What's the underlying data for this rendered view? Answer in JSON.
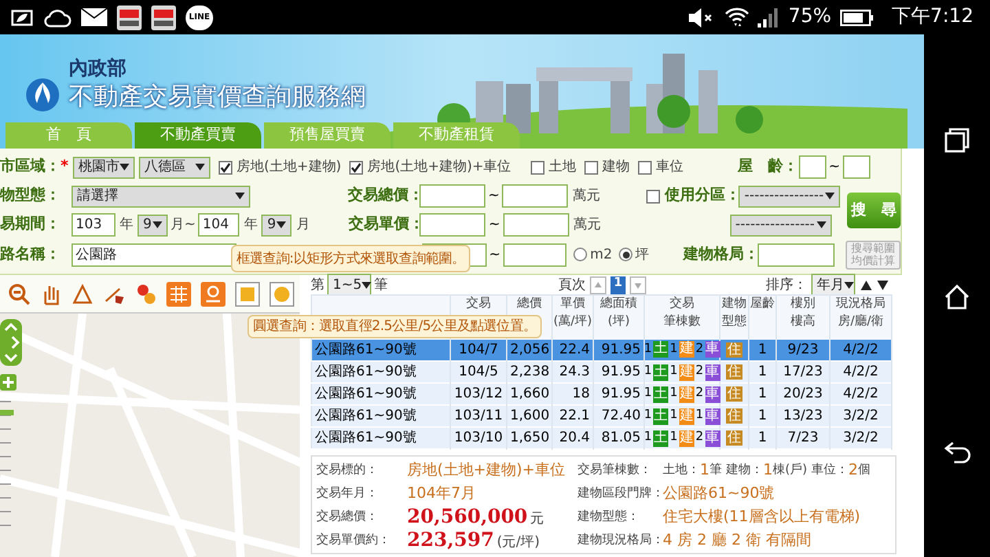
{
  "status_bar": {
    "apps": [
      {
        "kind": "youku"
      },
      {
        "kind": "youku"
      },
      {
        "kind": "line",
        "label": "LINE"
      }
    ],
    "battery": "75%",
    "time": "下午7:12"
  },
  "header": {
    "ministry": "內政部",
    "site_title": "不動產交易實價查詢服務網"
  },
  "nav_tabs": [
    {
      "label": "首　頁",
      "selected": false
    },
    {
      "label": "不動產買賣",
      "selected": true
    },
    {
      "label": "預售屋買賣",
      "selected": false
    },
    {
      "label": "不動產租賃",
      "selected": false
    }
  ],
  "form": {
    "area": {
      "label": "市區域：",
      "required_mark": "*",
      "city": "桃園市",
      "district": "八德區"
    },
    "property_types": [
      {
        "label": "房地(土地+建物)",
        "checked": true
      },
      {
        "label": "房地(土地+建物)+車位",
        "checked": true
      },
      {
        "label": "土地",
        "checked": false
      },
      {
        "label": "建物",
        "checked": false
      },
      {
        "label": "車位",
        "checked": false
      }
    ],
    "age": {
      "label": "屋　齡：",
      "separator": "~"
    },
    "building_type": {
      "label": "物型態：",
      "value": "請選擇"
    },
    "total_price": {
      "label": "交易總價：",
      "separator": "~",
      "unit": "萬元"
    },
    "unit_price": {
      "label": "交易單價：",
      "separator": "~",
      "unit": "萬元"
    },
    "period": {
      "label": "易期間：",
      "from_year": "103",
      "from_year_unit": "年",
      "from_month": "9",
      "from_month_unit": "月~",
      "to_year": "104",
      "to_year_unit": "年",
      "to_month": "9",
      "to_month_unit": "月"
    },
    "road": {
      "label": "路名稱：",
      "value": "公園路"
    },
    "floor_area": {
      "separator": "~",
      "units": [
        {
          "label": "m2",
          "selected": false
        },
        {
          "label": "坪",
          "selected": true
        }
      ]
    },
    "zoning": {
      "label": "使用分區：",
      "checked": false,
      "select_1": "----------------",
      "select_2": "----------------"
    },
    "layout": {
      "label": "建物格局："
    },
    "search_button": "搜　尋",
    "calc_button": "搜尋範圍均價計算"
  },
  "tooltips": [
    "框選查詢:以矩形方式來選取查詢範圍。",
    "圓選查詢：選取直徑2.5公里/5公里及點選位置。"
  ],
  "pager": {
    "prefix": "第",
    "range": "1~5",
    "suffix": "筆",
    "page_label": "頁次",
    "page": "1",
    "sort_label": "排序：",
    "sort_value": "年月"
  },
  "table": {
    "columns": [
      [
        "交易"
      ],
      [
        "總價"
      ],
      [
        "單價",
        "(萬/坪)"
      ],
      [
        "總面積",
        "(坪)"
      ],
      [
        "交易",
        "筆棟數"
      ],
      [
        "建物",
        "型態"
      ],
      [
        "屋齡"
      ],
      [
        "樓別",
        "樓高"
      ],
      [
        "現況格局",
        "房/廳/衛"
      ]
    ],
    "rows": [
      {
        "selected": true,
        "address": "公園路61~90號",
        "date": "104/7",
        "total": "2,056",
        "unit": "22.4",
        "area": "91.95",
        "counts": [
          {
            "n": "1",
            "tag": "土",
            "color": "#1e9a1e"
          },
          {
            "n": "1",
            "tag": "建",
            "color": "#f28c16"
          },
          {
            "n": "2",
            "tag": "車",
            "color": "#8a4fd6"
          }
        ],
        "type_tag": "住",
        "age": "1",
        "floor": "9/23",
        "layout": "4/2/2"
      },
      {
        "selected": false,
        "address": "公園路61~90號",
        "date": "104/5",
        "total": "2,238",
        "unit": "24.3",
        "area": "91.95",
        "counts": [
          {
            "n": "1",
            "tag": "土",
            "color": "#1e9a1e"
          },
          {
            "n": "1",
            "tag": "建",
            "color": "#f28c16"
          },
          {
            "n": "2",
            "tag": "車",
            "color": "#8a4fd6"
          }
        ],
        "type_tag": "住",
        "age": "1",
        "floor": "17/23",
        "layout": "4/2/2"
      },
      {
        "selected": false,
        "address": "公園路61~90號",
        "date": "103/12",
        "total": "1,660",
        "unit": "18",
        "area": "91.95",
        "counts": [
          {
            "n": "1",
            "tag": "土",
            "color": "#1e9a1e"
          },
          {
            "n": "1",
            "tag": "建",
            "color": "#f28c16"
          },
          {
            "n": "2",
            "tag": "車",
            "color": "#8a4fd6"
          }
        ],
        "type_tag": "住",
        "age": "1",
        "floor": "20/23",
        "layout": "4/2/2"
      },
      {
        "selected": false,
        "address": "公園路61~90號",
        "date": "103/11",
        "total": "1,600",
        "unit": "22.1",
        "area": "72.40",
        "counts": [
          {
            "n": "1",
            "tag": "土",
            "color": "#1e9a1e"
          },
          {
            "n": "1",
            "tag": "建",
            "color": "#f28c16"
          },
          {
            "n": "1",
            "tag": "車",
            "color": "#8a4fd6"
          }
        ],
        "type_tag": "住",
        "age": "1",
        "floor": "13/23",
        "layout": "3/2/2"
      },
      {
        "selected": false,
        "address": "公園路61~90號",
        "date": "103/10",
        "total": "1,650",
        "unit": "20.4",
        "area": "81.05",
        "counts": [
          {
            "n": "1",
            "tag": "土",
            "color": "#1e9a1e"
          },
          {
            "n": "1",
            "tag": "建",
            "color": "#f28c16"
          },
          {
            "n": "2",
            "tag": "車",
            "color": "#8a4fd6"
          }
        ],
        "type_tag": "住",
        "age": "1",
        "floor": "7/23",
        "layout": "3/2/2"
      }
    ]
  },
  "details": {
    "left": [
      {
        "kind": "plain",
        "label": "交易標的：",
        "value": "房地(土地+建物)+車位"
      },
      {
        "kind": "plain",
        "label": "交易年月：",
        "value": "104年7月"
      },
      {
        "kind": "price",
        "label": "交易總價：",
        "value": "20,560,000",
        "unit": "元"
      },
      {
        "kind": "price",
        "label": "交易單價約：",
        "value": "223,597",
        "unit": "(元/坪)"
      }
    ],
    "counts_label": "交易筆棟數：",
    "counts": [
      {
        "label": "土地：",
        "n": "1",
        "unit": "筆"
      },
      {
        "label": "建物：",
        "n": "1",
        "unit": "棟(戶)"
      },
      {
        "label": "車位：",
        "n": "2",
        "unit": "個"
      }
    ],
    "right": [
      {
        "label": "建物區段門牌：",
        "value": "公園路61~90號"
      },
      {
        "label": "建物型態：",
        "value": "住宅大樓(11層含以上有電梯)"
      },
      {
        "label": "建物現況格局：",
        "value": "4 房 2 廳 2 衛 有隔間"
      }
    ]
  }
}
